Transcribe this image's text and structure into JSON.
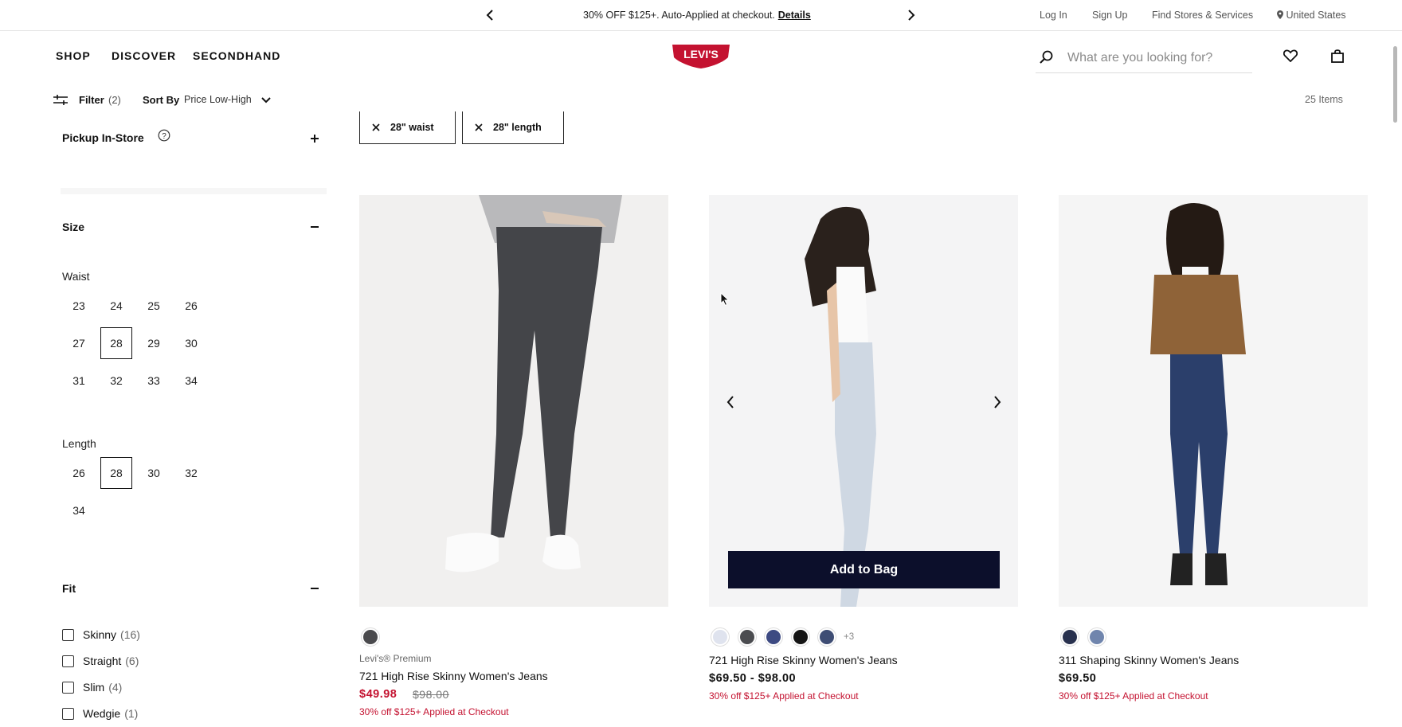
{
  "promo": {
    "text": "30% OFF $125+. Auto-Applied at checkout.",
    "details_link": "Details"
  },
  "utility_nav": {
    "login": "Log In",
    "signup": "Sign Up",
    "stores": "Find Stores & Services",
    "region": "United States"
  },
  "main_nav": {
    "shop": "SHOP",
    "discover": "DISCOVER",
    "secondhand": "SECONDHAND"
  },
  "logo_text": "LEVI'S",
  "search": {
    "placeholder": "What are you looking for?"
  },
  "filter_bar": {
    "filter_label": "Filter",
    "filter_count": "(2)",
    "sort_label": "Sort By",
    "sort_value": "Price Low-High",
    "items_count": "25 Items"
  },
  "applied_filters": [
    {
      "label": "28\" waist"
    },
    {
      "label": "28\" length"
    }
  ],
  "sidebar": {
    "pickup": {
      "heading": "Pickup In-Store"
    },
    "size": {
      "heading": "Size",
      "waist_label": "Waist",
      "waist_options": [
        "23",
        "24",
        "25",
        "26",
        "27",
        "28",
        "29",
        "30",
        "31",
        "32",
        "33",
        "34"
      ],
      "length_label": "Length",
      "length_options": [
        "26",
        "28",
        "30",
        "32",
        "34"
      ]
    },
    "fit": {
      "heading": "Fit",
      "options": [
        {
          "label": "Skinny",
          "count": "(16)"
        },
        {
          "label": "Straight",
          "count": "(6)"
        },
        {
          "label": "Slim",
          "count": "(4)"
        },
        {
          "label": "Wedgie",
          "count": "(1)"
        }
      ]
    }
  },
  "products": [
    {
      "brand": "Levi's® Premium",
      "name": "721 High Rise Skinny Women's Jeans",
      "price": "$49.98",
      "original_price": "$98.00",
      "promo": "30% off $125+ Applied at Checkout",
      "swatches": [
        "#4a4a4d"
      ]
    },
    {
      "name": "721 High Rise Skinny Women's Jeans",
      "price": "$69.50 - $98.00",
      "promo": "30% off $125+ Applied at Checkout",
      "swatches": [
        "#dfe3ee",
        "#4b4c50",
        "#3d4a82",
        "#151515",
        "#3e4d74"
      ],
      "more_swatches": "+3",
      "add_to_bag": "Add to Bag"
    },
    {
      "name": "311 Shaping Skinny Women's Jeans",
      "price": "$69.50",
      "promo": "30% off $125+ Applied at Checkout",
      "swatches": [
        "#28314e",
        "#7085ad"
      ]
    }
  ]
}
